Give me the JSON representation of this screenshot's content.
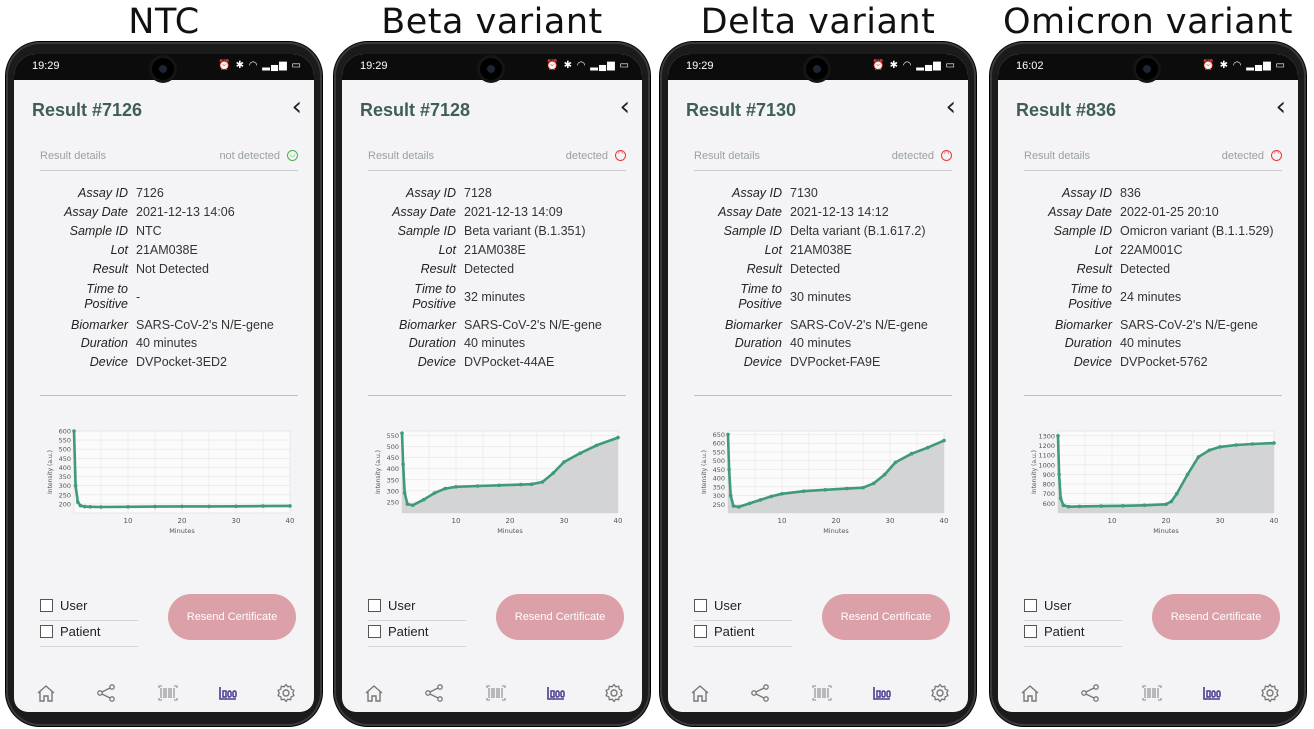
{
  "colors": {
    "accent_green": "#3f9a7c",
    "title_green": "#3f5e57",
    "button_pink": "#dba0a8",
    "detected_red": "#e53935",
    "not_detected_green": "#4caf50"
  },
  "panels": [
    {
      "heading": "NTC",
      "status_time": "19:29",
      "title": "Result #7126",
      "details_label": "Result details",
      "status_text": "not detected",
      "status_icon": "smile-icon",
      "fields": {
        "assay_id": "7126",
        "assay_date": "2021-12-13 14:06",
        "sample_id": "NTC",
        "lot": "21AM038E",
        "result": "Not Detected",
        "time_to_positive": "-",
        "biomarker": "SARS-CoV-2's N/E-gene",
        "duration": "40 minutes",
        "device": "DVPocket-3ED2"
      },
      "chart_data": {
        "type": "line",
        "ylabel": "Intensity (a.u.)",
        "xlabel": "Minutes",
        "xlim": [
          0,
          40
        ],
        "ylim": [
          150,
          600
        ],
        "y_ticks": [
          "600",
          "550",
          "500",
          "450",
          "400",
          "350",
          "300",
          "250",
          "200"
        ],
        "x_ticks": [
          "10",
          "20",
          "30",
          "40"
        ],
        "grid": true,
        "x": [
          0,
          0.3,
          0.7,
          1.2,
          2,
          3,
          5,
          10,
          15,
          20,
          25,
          30,
          35,
          40
        ],
        "y": [
          600,
          300,
          210,
          190,
          185,
          184,
          183,
          184,
          185,
          186,
          186,
          187,
          188,
          189
        ]
      }
    },
    {
      "heading": "Beta variant",
      "status_time": "19:29",
      "title": "Result #7128",
      "details_label": "Result details",
      "status_text": "detected",
      "status_icon": "frown-icon",
      "fields": {
        "assay_id": "7128",
        "assay_date": "2021-12-13 14:09",
        "sample_id": "Beta variant (B.1.351)",
        "lot": "21AM038E",
        "result": "Detected",
        "time_to_positive": "32 minutes",
        "biomarker": "SARS-CoV-2's N/E-gene",
        "duration": "40 minutes",
        "device": "DVPocket-44AE"
      },
      "chart_data": {
        "type": "area",
        "ylabel": "Intensity (a.u.)",
        "xlabel": "Minutes",
        "xlim": [
          0,
          40
        ],
        "ylim": [
          200,
          570
        ],
        "y_ticks": [
          "550",
          "500",
          "450",
          "400",
          "350",
          "300",
          "250"
        ],
        "x_ticks": [
          "10",
          "20",
          "30",
          "40"
        ],
        "grid": true,
        "x": [
          0,
          0.2,
          0.5,
          1,
          2,
          4,
          6,
          8,
          10,
          14,
          18,
          22,
          24,
          26,
          28,
          30,
          33,
          36,
          40
        ],
        "y": [
          560,
          420,
          290,
          240,
          235,
          260,
          290,
          310,
          318,
          322,
          325,
          328,
          330,
          340,
          380,
          430,
          470,
          505,
          540
        ]
      }
    },
    {
      "heading": "Delta variant",
      "status_time": "19:29",
      "title": "Result #7130",
      "details_label": "Result details",
      "status_text": "detected",
      "status_icon": "frown-icon",
      "fields": {
        "assay_id": "7130",
        "assay_date": "2021-12-13 14:12",
        "sample_id": "Delta variant (B.1.617.2)",
        "lot": "21AM038E",
        "result": "Detected",
        "time_to_positive": "30 minutes",
        "biomarker": "SARS-CoV-2's N/E-gene",
        "duration": "40 minutes",
        "device": "DVPocket-FA9E"
      },
      "chart_data": {
        "type": "area",
        "ylabel": "Intensity (a.u.)",
        "xlabel": "Minutes",
        "xlim": [
          0,
          40
        ],
        "ylim": [
          200,
          670
        ],
        "y_ticks": [
          "650",
          "600",
          "550",
          "500",
          "450",
          "400",
          "350",
          "300",
          "250"
        ],
        "x_ticks": [
          "10",
          "20",
          "30",
          "40"
        ],
        "grid": true,
        "x": [
          0,
          0.2,
          0.5,
          1,
          2,
          4,
          6,
          8,
          10,
          14,
          18,
          22,
          25,
          27,
          29,
          31,
          34,
          37,
          40
        ],
        "y": [
          650,
          450,
          300,
          240,
          235,
          255,
          275,
          295,
          310,
          325,
          333,
          340,
          345,
          370,
          420,
          490,
          540,
          575,
          615
        ]
      }
    },
    {
      "heading": "Omicron variant",
      "status_time": "16:02",
      "title": "Result #836",
      "details_label": "Result details",
      "status_text": "detected",
      "status_icon": "frown-icon",
      "fields": {
        "assay_id": "836",
        "assay_date": "2022-01-25 20:10",
        "sample_id": "Omicron variant (B.1.1.529)",
        "lot": "22AM001C",
        "result": "Detected",
        "time_to_positive": "24 minutes",
        "biomarker": "SARS-CoV-2's N/E-gene",
        "duration": "40 minutes",
        "device": "DVPocket-5762"
      },
      "chart_data": {
        "type": "area",
        "ylabel": "Intensity (a.u.)",
        "xlabel": "Minutes",
        "xlim": [
          0,
          40
        ],
        "ylim": [
          500,
          1350
        ],
        "y_ticks": [
          "1300",
          "1200",
          "1100",
          "1000",
          "900",
          "800",
          "700",
          "600"
        ],
        "x_ticks": [
          "10",
          "20",
          "30",
          "40"
        ],
        "grid": true,
        "x": [
          0,
          0.2,
          0.5,
          1,
          2,
          4,
          8,
          12,
          16,
          20,
          21,
          22,
          24,
          26,
          28,
          30,
          33,
          36,
          40
        ],
        "y": [
          1300,
          900,
          650,
          580,
          565,
          568,
          572,
          575,
          580,
          590,
          620,
          700,
          900,
          1080,
          1150,
          1185,
          1205,
          1215,
          1225
        ]
      }
    }
  ],
  "labels": {
    "assay_id": "Assay ID",
    "assay_date": "Assay Date",
    "sample_id": "Sample ID",
    "lot": "Lot",
    "result": "Result",
    "time_to": "Time to",
    "positive": "Positive",
    "biomarker": "Biomarker",
    "duration": "Duration",
    "device": "Device",
    "user_checkbox": "User",
    "patient_checkbox": "Patient",
    "resend_button": "Resend Certificate"
  },
  "nav_icons": [
    "home-icon",
    "share-icon",
    "barcode-icon",
    "results-icon",
    "settings-icon"
  ]
}
